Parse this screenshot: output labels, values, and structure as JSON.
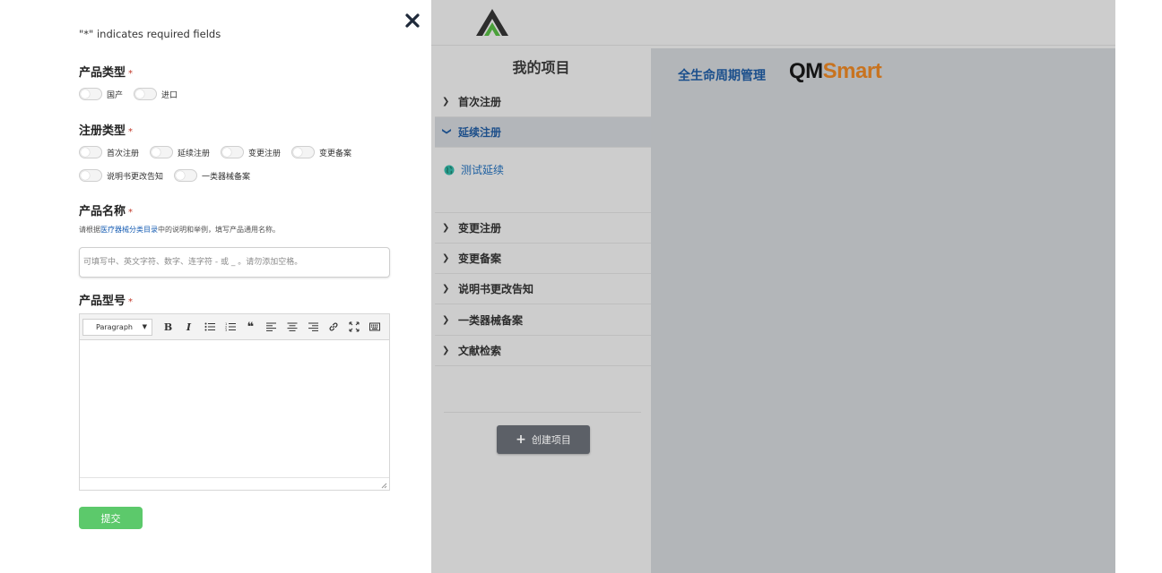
{
  "form": {
    "required_note": "\"*\" indicates required fields",
    "close_label": "×",
    "product_type": {
      "label": "产品类型",
      "required_mark": "*",
      "options": [
        "国产",
        "进口"
      ]
    },
    "registration_type": {
      "label": "注册类型",
      "required_mark": "*",
      "options_row1": [
        "首次注册",
        "延续注册",
        "变更注册",
        "变更备案"
      ],
      "options_row2": [
        "说明书更改告知",
        "一类器械备案"
      ]
    },
    "product_name": {
      "label": "产品名称",
      "required_mark": "*",
      "help_prefix": "请根据",
      "help_link": "医疗器械分类目录",
      "help_suffix": "中的说明和举例，填写产品通用名称。",
      "placeholder": "可填写中、英文字符、数字、连字符 - 或 _ 。请勿添加空格。",
      "value": ""
    },
    "product_model": {
      "label": "产品型号",
      "required_mark": "*",
      "format_select": "Paragraph"
    },
    "submit_label": "提交"
  },
  "app": {
    "sidebar_title": "我的项目",
    "menu": [
      {
        "label": "首次注册",
        "expanded": false
      },
      {
        "label": "延续注册",
        "expanded": true
      },
      {
        "label": "变更注册",
        "expanded": false
      },
      {
        "label": "变更备案",
        "expanded": false
      },
      {
        "label": "说明书更改告知",
        "expanded": false
      },
      {
        "label": "一类器械备案",
        "expanded": false
      },
      {
        "label": "文献检索",
        "expanded": false
      }
    ],
    "sub_item": "测试延续",
    "create_button": "创建项目",
    "content_title": "全生命周期管理",
    "brand_part1": "QM",
    "brand_part2": "Smart"
  },
  "colors": {
    "submit": "#5cc96b",
    "link": "#1a5fb4",
    "active_text": "#1d4f8a",
    "brand_orange": "#c8731f"
  }
}
